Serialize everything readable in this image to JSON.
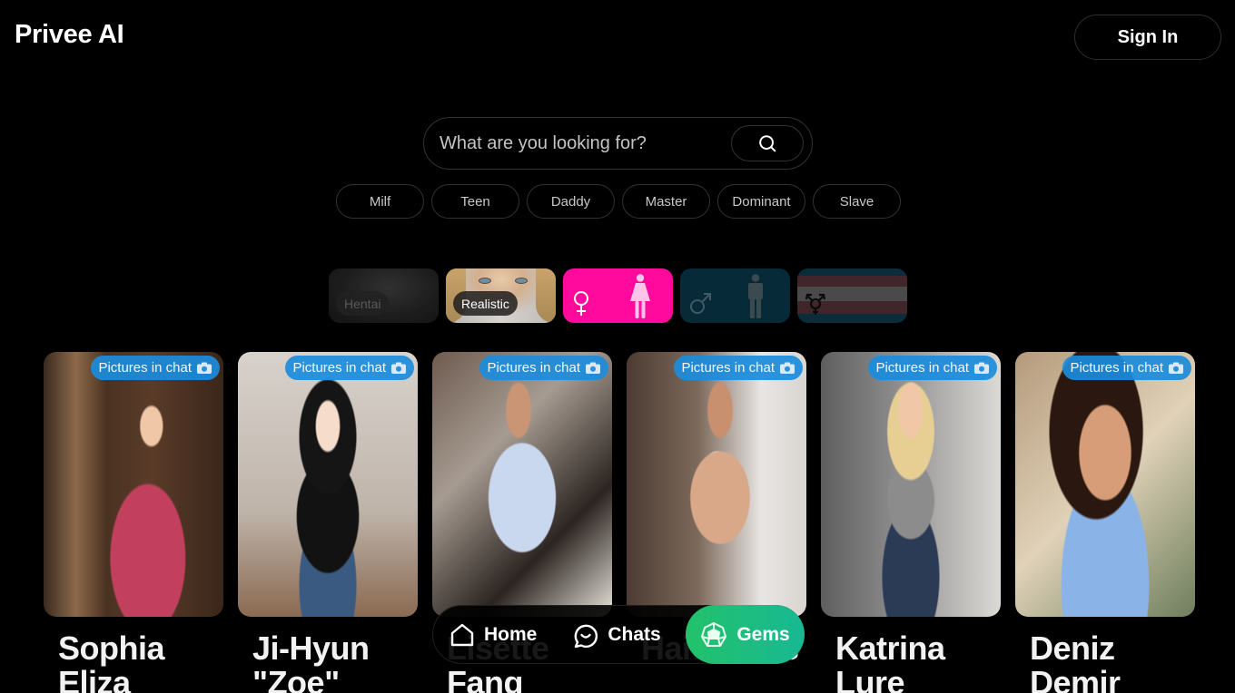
{
  "header": {
    "logo": "Privee AI",
    "sign_in_label": "Sign In"
  },
  "search": {
    "placeholder": "What are you looking for?",
    "value": "",
    "button_icon": "search-icon"
  },
  "tags": [
    "Milf",
    "Teen",
    "Daddy",
    "Master",
    "Dominant",
    "Slave"
  ],
  "style_filters": [
    {
      "label": "Hentai",
      "selected": false
    },
    {
      "label": "Realistic",
      "selected": true
    }
  ],
  "gender_filters": [
    {
      "name": "female",
      "icon": "female-symbol-icon",
      "selected": true,
      "color": "#ff0a9c"
    },
    {
      "name": "male",
      "icon": "male-symbol-icon",
      "selected": false,
      "color": "#062a37"
    },
    {
      "name": "trans",
      "icon": "transgender-symbol-icon",
      "selected": false,
      "color": "#0b2d3b"
    }
  ],
  "cards": [
    {
      "name": "Sophia Eliza",
      "badge": "Pictures in chat"
    },
    {
      "name": "Ji-Hyun \"Zoe\"",
      "badge": "Pictures in chat"
    },
    {
      "name": "Lisette Fang",
      "badge": "Pictures in chat"
    },
    {
      "name": "Hai… Kies",
      "badge": "Pictures in chat"
    },
    {
      "name": "Katrina Lure",
      "badge": "Pictures in chat"
    },
    {
      "name": "Deniz Demir",
      "badge": "Pictures in chat"
    }
  ],
  "bottom_nav": {
    "items": [
      {
        "label": "Home",
        "icon": "home-icon",
        "active": false
      },
      {
        "label": "Chats",
        "icon": "chat-bubble-icon",
        "active": false
      },
      {
        "label": "Gems",
        "icon": "gem-icon",
        "active": true
      }
    ]
  },
  "colors": {
    "background": "#000000",
    "badge_blue": "#1b8cdc",
    "female_pink": "#ff0a9c",
    "gems_green": "#23c26a"
  }
}
